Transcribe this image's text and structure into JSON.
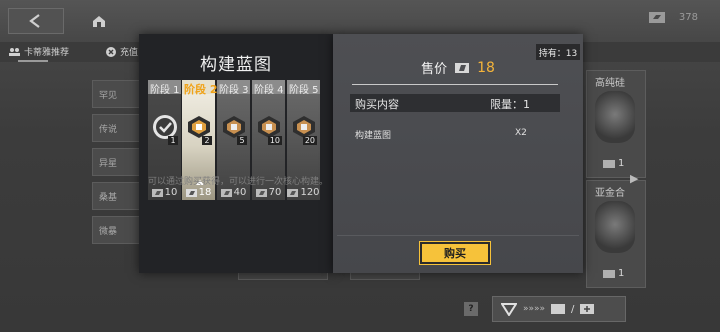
{
  "colors": {
    "accent": "#f4b43a",
    "selected_stage_label": "#f0a31a",
    "buy_button": "#f6c23a"
  },
  "header": {
    "back_icon": "chevron-left-icon",
    "home_icon": "home-icon",
    "currency_value": "378"
  },
  "tabs": [
    {
      "label": "卡蒂雅推荐"
    },
    {
      "label": "充值"
    }
  ],
  "background_list": [
    {
      "label": "罕见"
    },
    {
      "label": "传说"
    },
    {
      "label": "异星"
    },
    {
      "label": "桑基"
    },
    {
      "label": "微暴"
    }
  ],
  "right_cards": [
    {
      "name": "高纯硅",
      "price": "1"
    },
    {
      "name": "亚金合",
      "price": "1"
    }
  ],
  "modal": {
    "title": "构建蓝图",
    "stages": [
      {
        "label": "阶段 1",
        "count": "1",
        "cost": "10",
        "state": "done"
      },
      {
        "label": "阶段 2",
        "count": "2",
        "cost": "18",
        "state": "selected"
      },
      {
        "label": "阶段 3",
        "count": "5",
        "cost": "40",
        "state": "locked"
      },
      {
        "label": "阶段 4",
        "count": "10",
        "cost": "70",
        "state": "locked"
      },
      {
        "label": "阶段 5",
        "count": "20",
        "cost": "120",
        "state": "locked"
      }
    ],
    "description": "可以通过购买获得，可以进行一次核心构建。",
    "owned_label": "持有：13",
    "price_label": "售价",
    "price_value": "18",
    "content_header": "购买内容",
    "limit_label": "限量：1",
    "item_name": "构建蓝图",
    "item_qty": "X2",
    "buy_label": "购买"
  },
  "bottom_bar": {
    "help_label": "?"
  }
}
